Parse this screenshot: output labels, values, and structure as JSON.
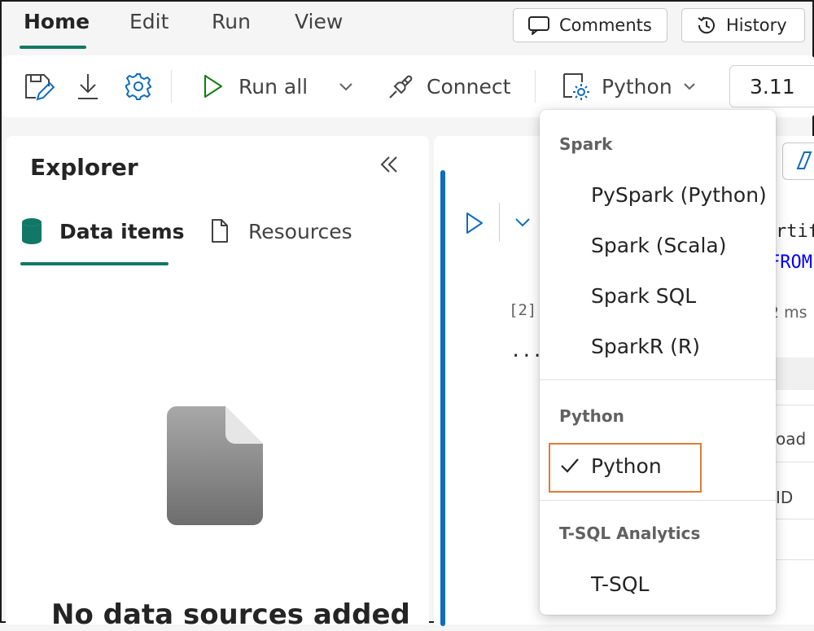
{
  "tabs": [
    {
      "label": "Home",
      "active": true
    },
    {
      "label": "Edit",
      "active": false
    },
    {
      "label": "Run",
      "active": false
    },
    {
      "label": "View",
      "active": false
    }
  ],
  "header_buttons": {
    "comments": "Comments",
    "history": "History"
  },
  "toolbar": {
    "run_all": "Run all",
    "connect": "Connect",
    "language": "Python",
    "version": "3.11"
  },
  "explorer": {
    "title": "Explorer",
    "tabs": [
      {
        "label": "Data items"
      },
      {
        "label": "Resources"
      }
    ],
    "empty_text": "No data sources added"
  },
  "editor": {
    "exec_count": "[2]",
    "ellipsis": "...",
    "code_partial_1": "rtif",
    "code_partial_2": "FROM",
    "duration_partial": "2 ms",
    "table_partial_1": "oad",
    "table_partial_2": "ID"
  },
  "language_menu": {
    "groups": [
      {
        "header": "Spark",
        "items": [
          "PySpark (Python)",
          "Spark (Scala)",
          "Spark SQL",
          "SparkR (R)"
        ]
      },
      {
        "header": "Python",
        "items": [
          "Python"
        ],
        "selected": "Python"
      },
      {
        "header": "T-SQL Analytics",
        "items": [
          "T-SQL"
        ]
      }
    ]
  },
  "colors": {
    "accent": "#117865",
    "brand_blue": "#0f6cbd",
    "run_green": "#107c10",
    "highlight_box": "#e07b39"
  }
}
